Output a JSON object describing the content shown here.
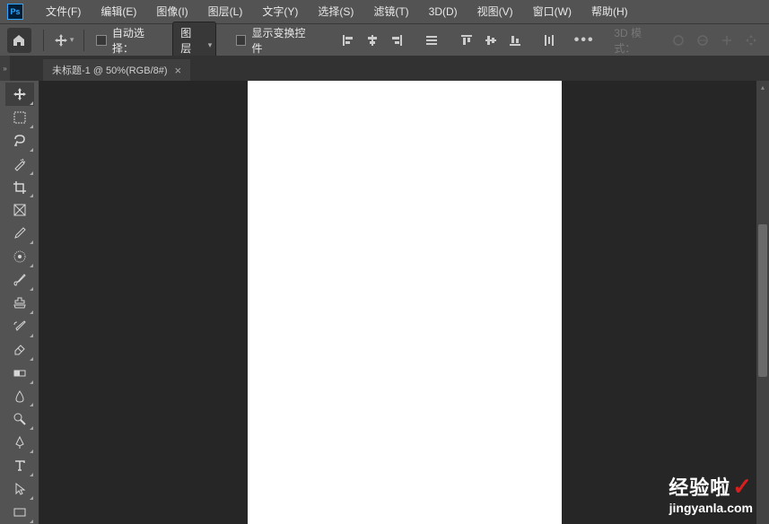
{
  "menubar": {
    "items": [
      "文件(F)",
      "编辑(E)",
      "图像(I)",
      "图层(L)",
      "文字(Y)",
      "选择(S)",
      "滤镜(T)",
      "3D(D)",
      "视图(V)",
      "窗口(W)",
      "帮助(H)"
    ]
  },
  "optionsbar": {
    "auto_select_label": "自动选择：",
    "layer_dropdown": "图层",
    "show_transform_label": "显示变换控件",
    "mode_3d_label": "3D 模式："
  },
  "tab": {
    "title": "未标题-1 @ 50%(RGB/8#)"
  },
  "watermark": {
    "brand": "经验啦",
    "url": "jingyanla.com"
  },
  "tools": [
    {
      "name": "move-tool",
      "active": true
    },
    {
      "name": "marquee-tool",
      "active": false
    },
    {
      "name": "lasso-tool",
      "active": false
    },
    {
      "name": "magic-wand-tool",
      "active": false
    },
    {
      "name": "crop-tool",
      "active": false
    },
    {
      "name": "frame-tool",
      "active": false
    },
    {
      "name": "eyedropper-tool",
      "active": false
    },
    {
      "name": "spot-healing-tool",
      "active": false
    },
    {
      "name": "brush-tool",
      "active": false
    },
    {
      "name": "clone-stamp-tool",
      "active": false
    },
    {
      "name": "history-brush-tool",
      "active": false
    },
    {
      "name": "eraser-tool",
      "active": false
    },
    {
      "name": "gradient-tool",
      "active": false
    },
    {
      "name": "blur-tool",
      "active": false
    },
    {
      "name": "dodge-tool",
      "active": false
    },
    {
      "name": "pen-tool",
      "active": false
    },
    {
      "name": "type-tool",
      "active": false
    },
    {
      "name": "path-selection-tool",
      "active": false
    },
    {
      "name": "rectangle-tool",
      "active": false
    }
  ]
}
